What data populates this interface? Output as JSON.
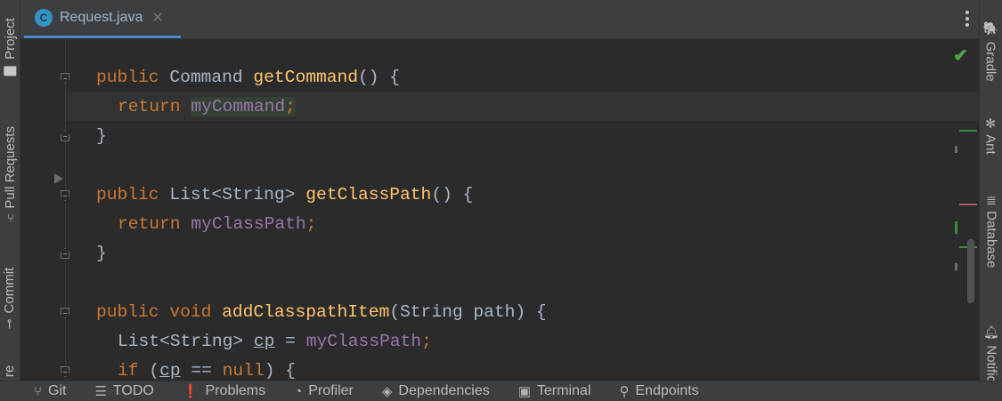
{
  "editor_tab": {
    "icon_letter": "C",
    "label": "Request.java",
    "close": "✕"
  },
  "left_tools": [
    {
      "label": "Project",
      "icon": "folder-icon"
    },
    {
      "label": "Pull Requests",
      "icon": "pull-request-icon"
    },
    {
      "label": "Commit",
      "icon": "commit-icon"
    },
    {
      "label": "re",
      "icon": ""
    }
  ],
  "right_tools": [
    {
      "label": "Gradle",
      "icon": "elephant-icon"
    },
    {
      "label": "Ant",
      "icon": "ant-icon"
    },
    {
      "label": "Database",
      "icon": "database-icon"
    },
    {
      "label": "Notifica",
      "icon": "bell-icon"
    }
  ],
  "code": {
    "l1": {
      "kw": "public",
      "type": "Command",
      "name": "getCommand",
      "rest": "() {"
    },
    "l2": {
      "kw": "return",
      "field": "myCommand",
      "rest": ";"
    },
    "l3": "}",
    "l4": {
      "kw": "public",
      "type": "List<String>",
      "name": "getClassPath",
      "rest": "() {"
    },
    "l5": {
      "kw": "return",
      "field": "myClassPath",
      "rest": ";"
    },
    "l6": "}",
    "l7": {
      "kw1": "public",
      "kw2": "void",
      "name": "addClasspathItem",
      "rest": "(String path) {"
    },
    "l8": {
      "type": "List<String>",
      "var": "cp",
      "op": "=",
      "field": "myClassPath",
      "rest": ";"
    },
    "l9": {
      "kw": "if",
      "open": "(",
      "var": "cp",
      "op": "==",
      "lit": "null",
      "rest": ") {"
    }
  },
  "status": {
    "inspection": "no-problems-check-icon"
  },
  "bottom_tabs": [
    {
      "label": "Git",
      "icon": "git-branch-icon"
    },
    {
      "label": "TODO",
      "icon": "list-icon"
    },
    {
      "label": "Problems",
      "icon": "warning-icon"
    },
    {
      "label": "Profiler",
      "icon": "profiler-icon"
    },
    {
      "label": "Dependencies",
      "icon": "layers-icon"
    },
    {
      "label": "Terminal",
      "icon": "terminal-icon"
    },
    {
      "label": "Endpoints",
      "icon": "endpoints-icon"
    }
  ],
  "colors": {
    "accent": "#4a88c7",
    "keyword": "#cc7832",
    "function": "#ffc66d",
    "field": "#9876aa",
    "ok": "#4fa34a"
  }
}
